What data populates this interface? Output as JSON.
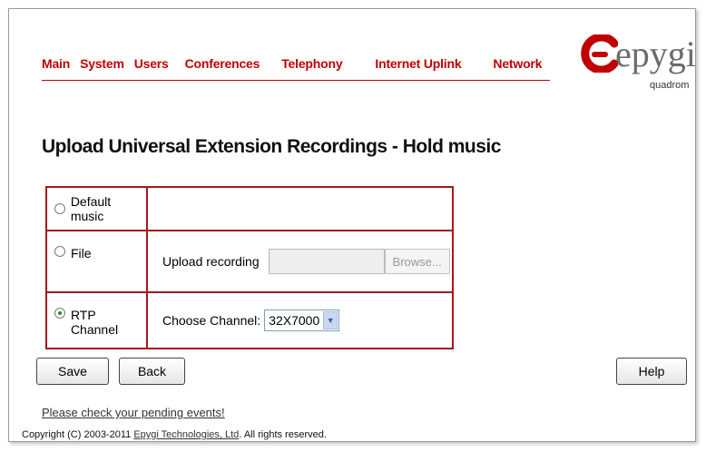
{
  "nav": {
    "items": [
      "Main",
      "System",
      "Users",
      "Conferences",
      "Telephony",
      "Internet Uplink",
      "Network"
    ]
  },
  "logo": {
    "word": "epygi",
    "sub": "quadrom",
    "icon": "epygi-logo-icon",
    "colors": {
      "mark": "#c00000",
      "word": "#6a6a6a"
    }
  },
  "page": {
    "title": "Upload Universal Extension Recordings - Hold music"
  },
  "form": {
    "options": [
      {
        "label": "Default music",
        "checked": false
      },
      {
        "label": "File",
        "checked": false
      },
      {
        "label": "RTP Channel",
        "checked": true
      }
    ],
    "upload_label": "Upload recording",
    "browse_label": "Browse...",
    "channel_label": "Choose Channel:",
    "channel_value": "32X7000"
  },
  "buttons": {
    "save": "Save",
    "back": "Back",
    "help": "Help"
  },
  "footer": {
    "pending": "Please check your pending events!",
    "copyright_pre": "Copyright (C) 2003-2011 ",
    "copyright_link": "Epygi Technologies, Ltd",
    "copyright_post": ". All rights reserved."
  },
  "colors": {
    "accent": "#c00000",
    "border": "#a01a1a"
  }
}
